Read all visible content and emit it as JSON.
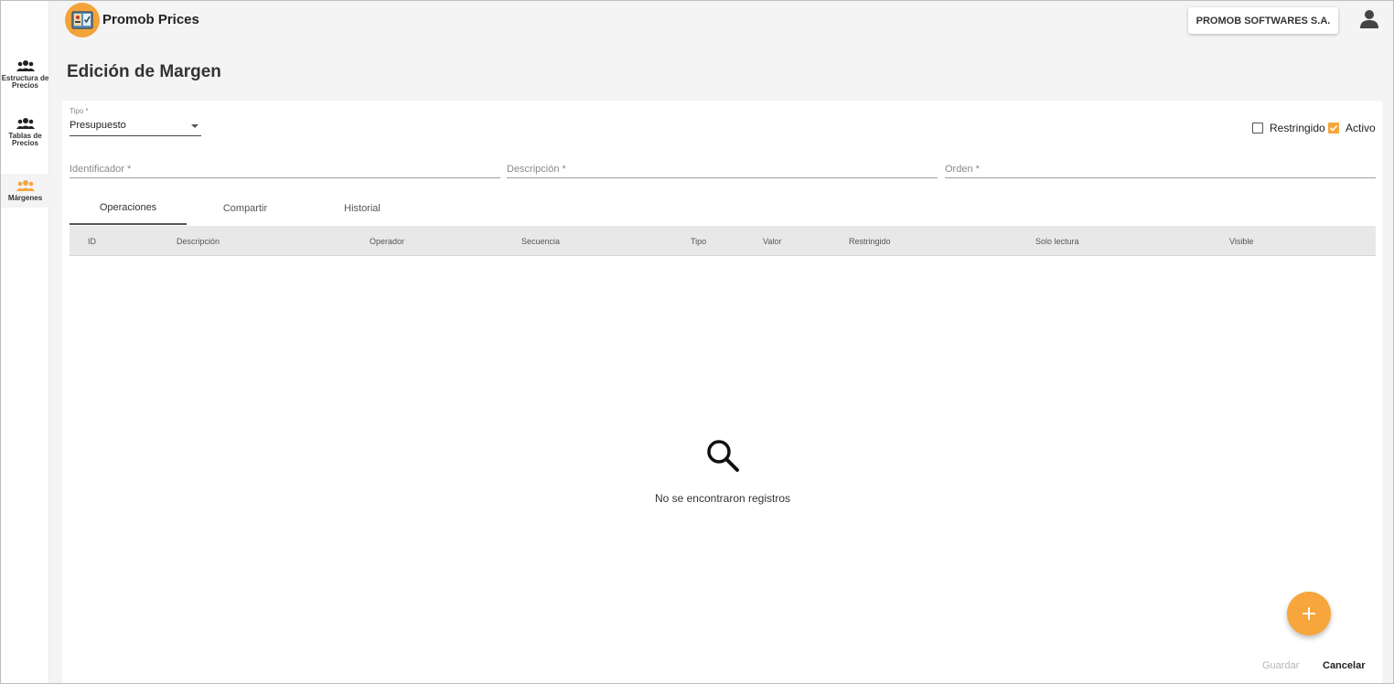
{
  "app": {
    "title": "Promob Prices",
    "company": "PROMOB SOFTWARES S.A."
  },
  "sidebar": {
    "items": [
      {
        "label": "Estructura de Precios",
        "icon": "group-icon",
        "active": false
      },
      {
        "label": "Tablas de Precios",
        "icon": "group-icon",
        "active": false
      },
      {
        "label": "Márgenes",
        "icon": "group-icon",
        "active": true
      }
    ]
  },
  "page": {
    "title": "Edición de Margen"
  },
  "form": {
    "tipo": {
      "label": "Tipo *",
      "value": "Presupuesto"
    },
    "restringido": {
      "label": "Restringido",
      "checked": false
    },
    "activo": {
      "label": "Activo",
      "checked": true
    },
    "identificador": {
      "placeholder": "Identificador *",
      "value": ""
    },
    "descripcion": {
      "placeholder": "Descripción *",
      "value": ""
    },
    "orden": {
      "placeholder": "Orden *",
      "value": ""
    }
  },
  "tabs": [
    {
      "label": "Operaciones",
      "active": true
    },
    {
      "label": "Compartir",
      "active": false
    },
    {
      "label": "Historial",
      "active": false
    }
  ],
  "table": {
    "columns": [
      "ID",
      "Descripción",
      "Operador",
      "Secuencia",
      "Tipo",
      "Valor",
      "Restringido",
      "Solo lectura",
      "Visible"
    ],
    "rows": [],
    "empty_text": "No se encontraron registros"
  },
  "actions": {
    "add_icon": "plus-icon",
    "save_label": "Guardar",
    "cancel_label": "Cancelar"
  },
  "colors": {
    "accent": "#f7a63c",
    "logo": "#f2a33a",
    "header_bg": "#e8e8e8"
  }
}
